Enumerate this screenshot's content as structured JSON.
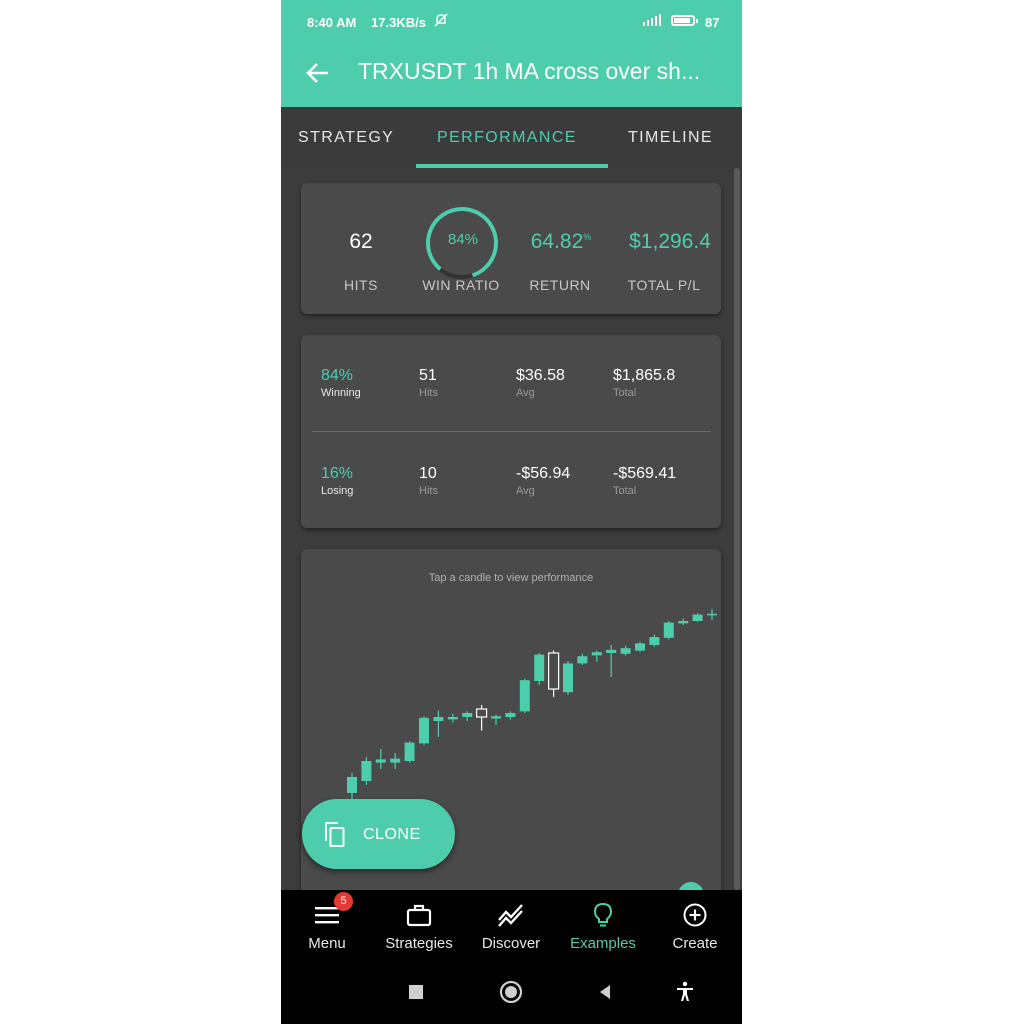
{
  "status_bar": {
    "time": "8:40 AM",
    "network_speed": "17.3KB/s",
    "battery": "87"
  },
  "app_bar": {
    "title": "TRXUSDT 1h MA cross over sh..."
  },
  "tabs": [
    {
      "label": "STRATEGY",
      "active": false
    },
    {
      "label": "PERFORMANCE",
      "active": true
    },
    {
      "label": "TIMELINE",
      "active": false
    }
  ],
  "summary": {
    "hits_value": "62",
    "hits_label": "HITS",
    "win_ratio_value": "84%",
    "win_ratio_fraction": 0.84,
    "win_ratio_label": "WIN RATIO",
    "return_value": "64.82",
    "return_unit": "%",
    "return_label": "RETURN",
    "total_pl_value": "$1,296.4",
    "total_pl_label": "TOTAL P/L"
  },
  "breakdown": {
    "winning": {
      "pct": "84%",
      "pct_label": "Winning",
      "hits": "51",
      "hits_label": "Hits",
      "avg": "$36.58",
      "avg_label": "Avg",
      "total": "$1,865.8",
      "total_label": "Total"
    },
    "losing": {
      "pct": "16%",
      "pct_label": "Losing",
      "hits": "10",
      "hits_label": "Hits",
      "avg": "-$56.94",
      "avg_label": "Avg",
      "total": "-$569.41",
      "total_label": "Total"
    }
  },
  "chart": {
    "hint": "Tap a candle to view performance",
    "up_color": "#4ecdac",
    "down_color": "#ffffff"
  },
  "chart_data": {
    "type": "candlestick",
    "title": "",
    "xlabel": "",
    "ylabel": "",
    "candles": [
      {
        "o": 2.0,
        "h": 4.5,
        "l": 1.0,
        "c": 4.0
      },
      {
        "o": 3.5,
        "h": 6.5,
        "l": 3.0,
        "c": 6.0
      },
      {
        "o": 5.8,
        "h": 7.5,
        "l": 5.0,
        "c": 6.2
      },
      {
        "o": 5.8,
        "h": 7.0,
        "l": 5.0,
        "c": 6.3
      },
      {
        "o": 6.0,
        "h": 8.5,
        "l": 5.8,
        "c": 8.3
      },
      {
        "o": 8.2,
        "h": 11.6,
        "l": 8.0,
        "c": 11.4
      },
      {
        "o": 11.0,
        "h": 12.3,
        "l": 9.0,
        "c": 11.5
      },
      {
        "o": 11.2,
        "h": 11.9,
        "l": 10.8,
        "c": 11.5
      },
      {
        "o": 11.5,
        "h": 12.2,
        "l": 11.0,
        "c": 12.0
      },
      {
        "o": 12.5,
        "h": 13.0,
        "l": 9.8,
        "c": 11.5
      },
      {
        "o": 11.3,
        "h": 11.8,
        "l": 10.5,
        "c": 11.6
      },
      {
        "o": 11.5,
        "h": 12.2,
        "l": 11.2,
        "c": 12.0
      },
      {
        "o": 12.2,
        "h": 16.3,
        "l": 12.0,
        "c": 16.1
      },
      {
        "o": 16.0,
        "h": 19.5,
        "l": 15.5,
        "c": 19.3
      },
      {
        "o": 19.5,
        "h": 19.8,
        "l": 14.0,
        "c": 15.0
      },
      {
        "o": 14.6,
        "h": 18.5,
        "l": 14.3,
        "c": 18.2
      },
      {
        "o": 18.2,
        "h": 19.4,
        "l": 18.0,
        "c": 19.1
      },
      {
        "o": 19.2,
        "h": 19.8,
        "l": 18.4,
        "c": 19.6
      },
      {
        "o": 19.5,
        "h": 20.5,
        "l": 16.5,
        "c": 19.9
      },
      {
        "o": 19.4,
        "h": 20.4,
        "l": 19.2,
        "c": 20.1
      },
      {
        "o": 19.8,
        "h": 20.9,
        "l": 19.6,
        "c": 20.7
      },
      {
        "o": 20.5,
        "h": 21.8,
        "l": 20.3,
        "c": 21.5
      },
      {
        "o": 21.4,
        "h": 23.5,
        "l": 21.2,
        "c": 23.3
      },
      {
        "o": 23.2,
        "h": 23.8,
        "l": 23.0,
        "c": 23.5
      },
      {
        "o": 23.5,
        "h": 24.5,
        "l": 23.4,
        "c": 24.3
      },
      {
        "o": 24.2,
        "h": 25.0,
        "l": 23.6,
        "c": 24.4
      },
      {
        "o": 24.3,
        "h": 25.0,
        "l": 23.6,
        "c": 24.4
      }
    ]
  },
  "clone_button": {
    "label": "CLONE"
  },
  "bottom_nav": {
    "menu_badge": "5",
    "items": [
      {
        "label": "Menu",
        "icon": "menu-icon"
      },
      {
        "label": "Strategies",
        "icon": "briefcase-icon"
      },
      {
        "label": "Discover",
        "icon": "chart-line-icon"
      },
      {
        "label": "Examples",
        "icon": "lightbulb-icon",
        "active": true
      },
      {
        "label": "Create",
        "icon": "plus-circle-icon"
      }
    ]
  },
  "colors": {
    "accent": "#4ecdac",
    "background": "#3c3c3c",
    "card": "#4a4a4a",
    "badge": "#e53935"
  }
}
